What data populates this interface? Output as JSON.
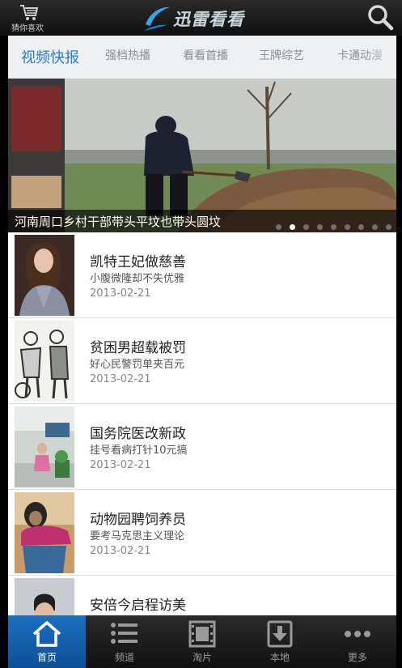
{
  "header": {
    "guess_label": "猜你喜欢",
    "brand": "迅雷看看",
    "cart_icon": "cart-icon",
    "search_icon": "search-icon"
  },
  "tabs": [
    {
      "label": "视频快报",
      "active": true
    },
    {
      "label": "强档热播"
    },
    {
      "label": "看看首播"
    },
    {
      "label": "王牌综艺"
    },
    {
      "label": "卡通动漫"
    }
  ],
  "banner": {
    "caption": "河南周口乡村干部带头平坟也带头圆坟",
    "slide_count": 9,
    "active_slide": 2
  },
  "items": [
    {
      "title": "凯特王妃做慈善",
      "subtitle": "小腹微隆却不失优雅",
      "date": "2013-02-21"
    },
    {
      "title": "贫困男超载被罚",
      "subtitle": "好心民警罚单夹百元",
      "date": "2013-02-21"
    },
    {
      "title": "国务院医改新政",
      "subtitle": "挂号看病打针10元搞",
      "date": "2013-02-21"
    },
    {
      "title": "动物园聘饲养员",
      "subtitle": "要考马克思主义理论",
      "date": "2013-02-21"
    },
    {
      "title": "安倍今启程访美",
      "subtitle": "",
      "date": ""
    }
  ],
  "bottom_nav": [
    {
      "label": "首页",
      "icon": "home-icon",
      "active": true
    },
    {
      "label": "频道",
      "icon": "list-icon"
    },
    {
      "label": "淘片",
      "icon": "film-icon"
    },
    {
      "label": "本地",
      "icon": "download-icon"
    },
    {
      "label": "更多",
      "icon": "more-icon"
    }
  ],
  "colors": {
    "accent": "#2a7ec8",
    "nav_active": "#1d6fc0",
    "topbar": "#1a1a1a"
  }
}
